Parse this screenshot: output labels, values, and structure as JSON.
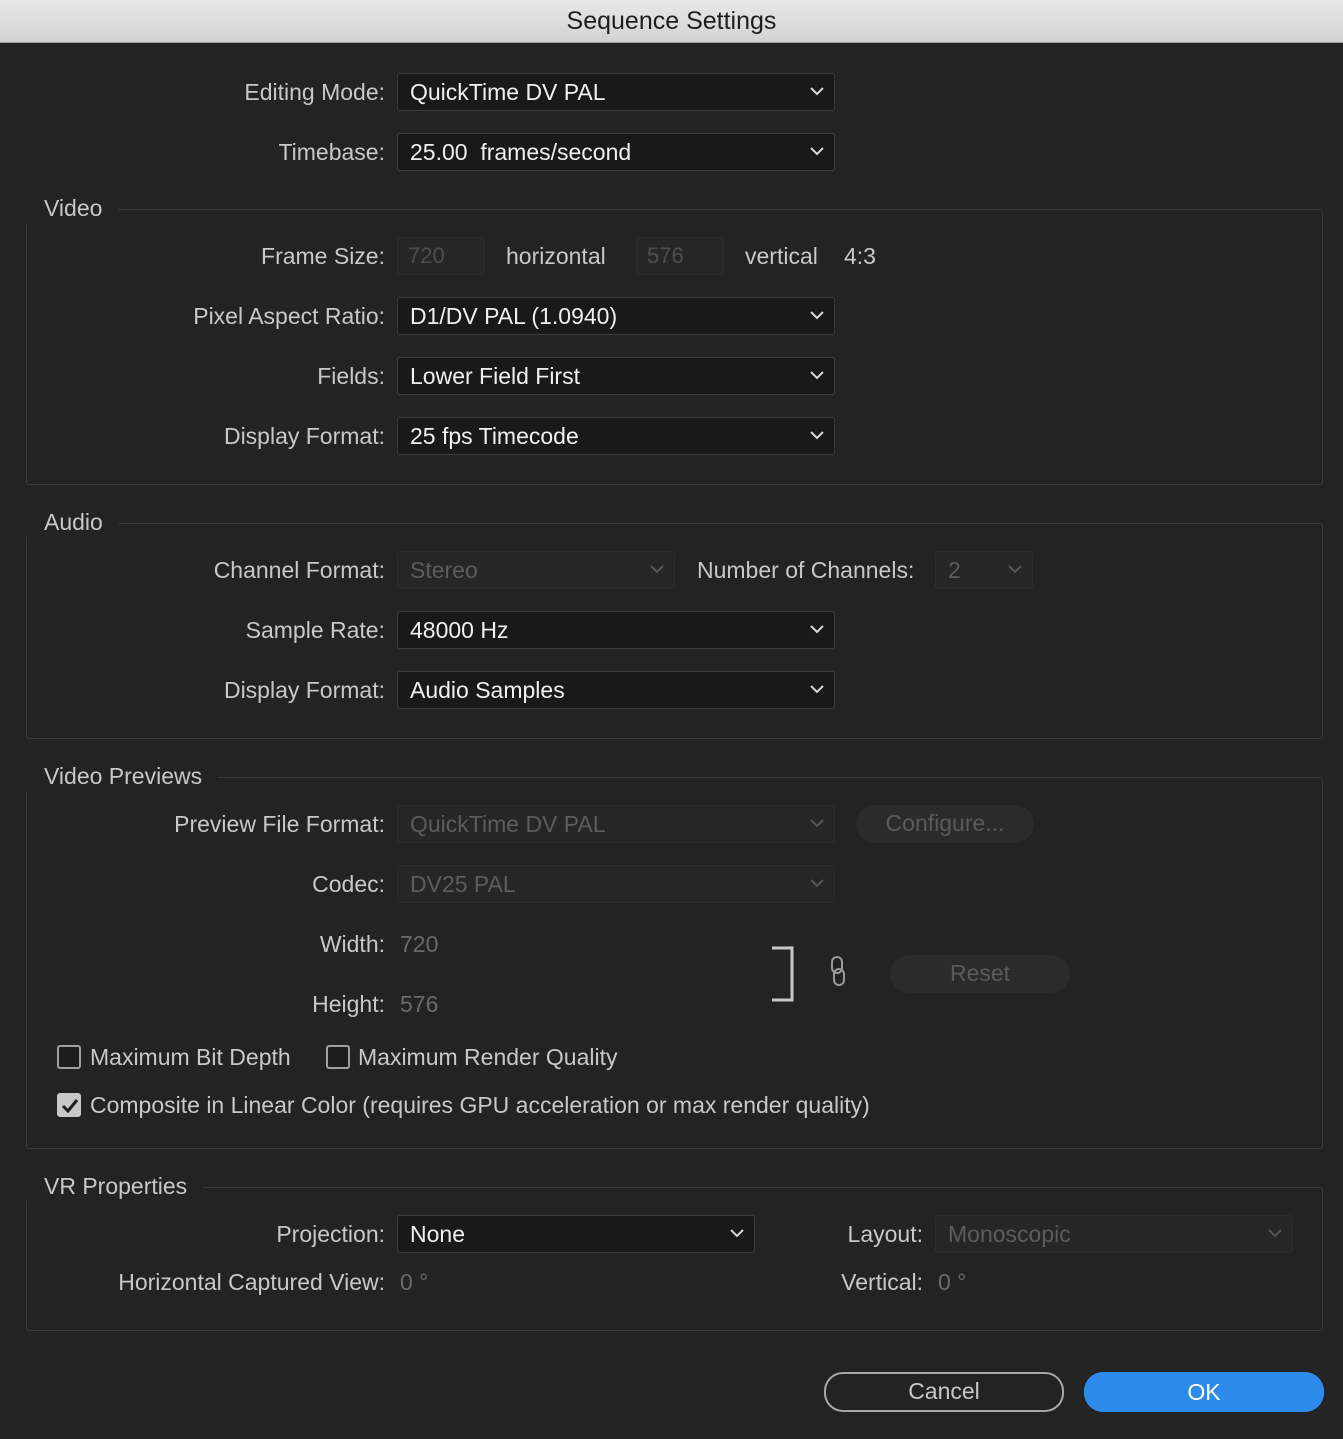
{
  "window": {
    "title": "Sequence Settings"
  },
  "general": {
    "editing_mode_label": "Editing Mode:",
    "editing_mode_value": "QuickTime DV PAL",
    "timebase_label": "Timebase:",
    "timebase_value": "25.00  frames/second"
  },
  "video": {
    "title": "Video",
    "frame_size_label": "Frame Size:",
    "frame_width": "720",
    "horizontal_label": "horizontal",
    "frame_height": "576",
    "vertical_label": "vertical",
    "aspect": "4:3",
    "pixel_aspect_label": "Pixel Aspect Ratio:",
    "pixel_aspect_value": "D1/DV PAL (1.0940)",
    "fields_label": "Fields:",
    "fields_value": "Lower Field First",
    "display_format_label": "Display Format:",
    "display_format_value": "25 fps Timecode"
  },
  "audio": {
    "title": "Audio",
    "channel_format_label": "Channel Format:",
    "channel_format_value": "Stereo",
    "num_channels_label": "Number of Channels:",
    "num_channels_value": "2",
    "sample_rate_label": "Sample Rate:",
    "sample_rate_value": "48000 Hz",
    "display_format_label": "Display Format:",
    "display_format_value": "Audio Samples"
  },
  "previews": {
    "title": "Video Previews",
    "file_format_label": "Preview File Format:",
    "file_format_value": "QuickTime DV PAL",
    "configure_label": "Configure...",
    "codec_label": "Codec:",
    "codec_value": "DV25 PAL",
    "width_label": "Width:",
    "width_value": "720",
    "height_label": "Height:",
    "height_value": "576",
    "reset_label": "Reset",
    "max_bit_depth_label": "Maximum Bit Depth",
    "max_render_quality_label": "Maximum Render Quality",
    "composite_linear_label": "Composite in Linear Color (requires GPU acceleration or max render quality)",
    "max_bit_depth_checked": false,
    "max_render_quality_checked": false,
    "composite_linear_checked": true
  },
  "vr": {
    "title": "VR Properties",
    "projection_label": "Projection:",
    "projection_value": "None",
    "layout_label": "Layout:",
    "layout_value": "Monoscopic",
    "h_view_label": "Horizontal Captured View:",
    "h_view_value": "0 °",
    "vertical_label": "Vertical:",
    "vertical_value": "0 °"
  },
  "buttons": {
    "cancel": "Cancel",
    "ok": "OK"
  },
  "colors": {
    "accent": "#2d8ceb",
    "background": "#232323"
  },
  "icons": [
    "chevron-down-icon",
    "link-icon",
    "checkmark-icon",
    "bracket-icon"
  ]
}
